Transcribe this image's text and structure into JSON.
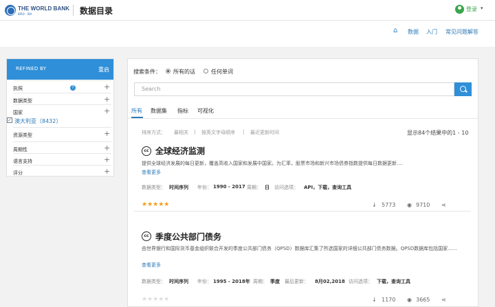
{
  "header": {
    "brand": "THE WORLD BANK",
    "brand_sub": "IBRD · IDA",
    "title": "数据目录",
    "login": "登录",
    "caret": "▾"
  },
  "subnav": {
    "home_icon": "home-icon",
    "items": [
      "数据",
      "入门",
      "常见问题解答"
    ]
  },
  "sidebar": {
    "heading": "REFINED BY",
    "reset": "重启",
    "filters": [
      "执照",
      "数据类型",
      "国家",
      "资源类型",
      "周期性",
      "语言支持",
      "评分"
    ],
    "help": "?",
    "checked_country": "澳大利亚（8432）",
    "plus": "+"
  },
  "search_conditions": {
    "label": "搜索条件：",
    "options": [
      "所有的话",
      "任何单词"
    ],
    "selected": 0
  },
  "search": {
    "placeholder": "Search",
    "icon": "search-icon"
  },
  "tabs": {
    "items": [
      "所有",
      "数据集",
      "指标",
      "可视化"
    ],
    "active": 0
  },
  "sort": {
    "label": "排序方式：",
    "options": [
      "最相关",
      "按英文字母顺序",
      "最近更新时间"
    ],
    "sep": "|"
  },
  "result_count": "显示84个结果中的1 - 10",
  "results": [
    {
      "title": "全球经济监测",
      "description": "提供全球经济发展的每日更新，覆盖高收入国家和发展中国家。为汇率，股票市场和新兴市场债券指数提供每日数据更新....",
      "more": "查看更多",
      "meta_labels": [
        "数据类型：",
        "年份：",
        "周期：",
        "访问选项："
      ],
      "meta_values": [
        "时间序列",
        "1990 - 2017",
        "日",
        "API，下载，查询工具"
      ],
      "rating": 5,
      "stars": "★★★★★",
      "downloads": "5773",
      "views": "9710"
    },
    {
      "title": "季度公共部门债务",
      "description": "由世界银行和国际货币基金组织联合开发的季度公共部门债务（QPSD）数据库汇集了所选国家的详细公共部门债务数据。QPSD数据库包括国家......",
      "more": "查看更多",
      "meta_labels": [
        "数据类型：",
        "年份：",
        "周期：",
        "最后更新：",
        "访问选项："
      ],
      "meta_values": [
        "时间序列",
        "1995 - 2018年",
        "季度",
        "8月02,2018",
        "下载，查询工具"
      ],
      "rating": 0,
      "stars": "★★★★★",
      "downloads": "1170",
      "views": "3665"
    }
  ],
  "icons": {
    "cc": "cc",
    "download": "↓",
    "view": "◉",
    "share": "⋖"
  },
  "colors": {
    "accent": "#2f8fd8",
    "link": "#2a7ab8",
    "login": "#3aa54a",
    "star": "#f39c12"
  }
}
